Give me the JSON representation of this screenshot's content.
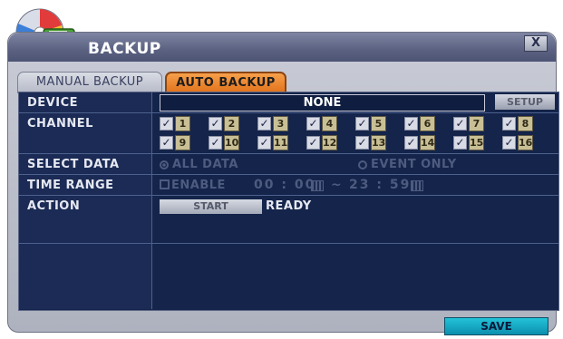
{
  "window": {
    "title": "BACKUP",
    "close_label": "X"
  },
  "tabs": [
    {
      "label": "MANUAL BACKUP"
    },
    {
      "label": "AUTO BACKUP"
    }
  ],
  "device": {
    "label": "DEVICE",
    "value": "NONE",
    "setup_label": "SETUP"
  },
  "channel": {
    "label": "CHANNEL",
    "channels": [
      "1",
      "2",
      "3",
      "4",
      "5",
      "6",
      "7",
      "8",
      "9",
      "10",
      "11",
      "12",
      "13",
      "14",
      "15",
      "16"
    ],
    "check_glyph": "✓"
  },
  "select_data": {
    "label": "SELECT DATA",
    "option_all": "ALL DATA",
    "option_event": "EVENT ONLY"
  },
  "time_range": {
    "label": "TIME RANGE",
    "enable_label": "ENABLE",
    "start_time": "00 : 00",
    "separator": "~",
    "end_time": "23 : 59"
  },
  "action": {
    "label": "ACTION",
    "start_label": "START",
    "status": "READY"
  },
  "footer": {
    "save_label": "SAVE"
  },
  "colors": {
    "accent_tab": "#e1701a",
    "panel": "#14244a",
    "save": "#0c8fae"
  }
}
